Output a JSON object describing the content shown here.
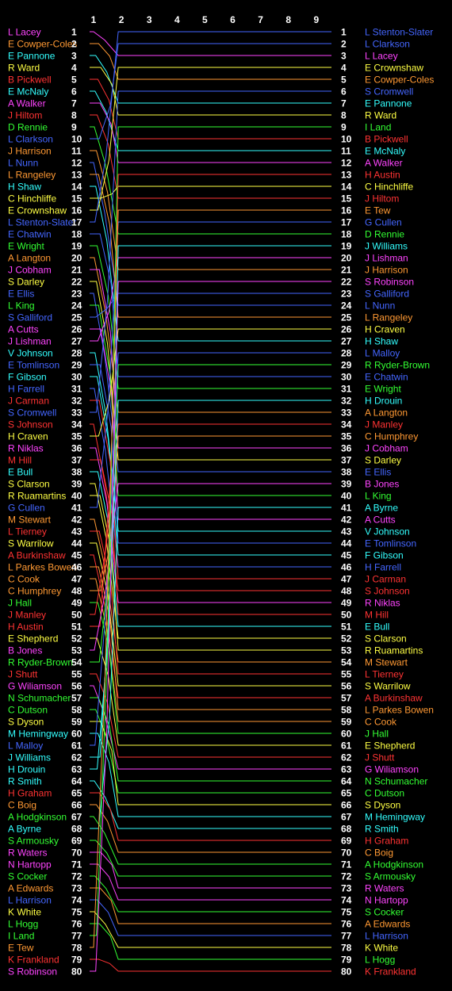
{
  "palette": {
    "magenta": "#ff44ff",
    "orange": "#ff9933",
    "cyan": "#33ffff",
    "yellow": "#ffff44",
    "red": "#ff3333",
    "blue": "#4466ff",
    "green": "#33ff33",
    "white": "#ffffff",
    "background": "#000000"
  },
  "chart_data": {
    "type": "line",
    "x": [
      1,
      2,
      3,
      4,
      5,
      6,
      7,
      8,
      9
    ],
    "xlim": [
      1,
      9
    ],
    "ylim": [
      1,
      80
    ],
    "y_inverted": true,
    "grid": false,
    "start_order": [
      {
        "name": "L Lacey",
        "color": "magenta"
      },
      {
        "name": "E Cowper-Coles",
        "color": "orange"
      },
      {
        "name": "E Pannone",
        "color": "cyan"
      },
      {
        "name": "R Ward",
        "color": "yellow"
      },
      {
        "name": "B Pickwell",
        "color": "red"
      },
      {
        "name": "E McNaly",
        "color": "cyan"
      },
      {
        "name": "A Walker",
        "color": "magenta"
      },
      {
        "name": "J Hiltom",
        "color": "red"
      },
      {
        "name": "D Rennie",
        "color": "green"
      },
      {
        "name": "L Clarkson",
        "color": "blue"
      },
      {
        "name": "J Harrison",
        "color": "orange"
      },
      {
        "name": "L Nunn",
        "color": "blue"
      },
      {
        "name": "L Rangeley",
        "color": "orange"
      },
      {
        "name": "H Shaw",
        "color": "cyan"
      },
      {
        "name": "C Hinchliffe",
        "color": "yellow"
      },
      {
        "name": "E Crownshaw",
        "color": "yellow"
      },
      {
        "name": "L Stenton-Slater",
        "color": "blue"
      },
      {
        "name": "E Chatwin",
        "color": "blue"
      },
      {
        "name": "E Wright",
        "color": "green"
      },
      {
        "name": "A Langton",
        "color": "orange"
      },
      {
        "name": "J Cobham",
        "color": "magenta"
      },
      {
        "name": "S Darley",
        "color": "yellow"
      },
      {
        "name": "E Ellis",
        "color": "blue"
      },
      {
        "name": "L King",
        "color": "green"
      },
      {
        "name": "S Galliford",
        "color": "blue"
      },
      {
        "name": "A Cutts",
        "color": "magenta"
      },
      {
        "name": "J Lishman",
        "color": "magenta"
      },
      {
        "name": "V Johnson",
        "color": "cyan"
      },
      {
        "name": "E Tomlinson",
        "color": "blue"
      },
      {
        "name": "F Gibson",
        "color": "cyan"
      },
      {
        "name": "H Farrell",
        "color": "blue"
      },
      {
        "name": "J Carman",
        "color": "red"
      },
      {
        "name": "S Cromwell",
        "color": "blue"
      },
      {
        "name": "S Johnson",
        "color": "red"
      },
      {
        "name": "H Craven",
        "color": "yellow"
      },
      {
        "name": "R Niklas",
        "color": "magenta"
      },
      {
        "name": "M Hill",
        "color": "red"
      },
      {
        "name": "E Bull",
        "color": "cyan"
      },
      {
        "name": "S Clarson",
        "color": "yellow"
      },
      {
        "name": "R Ruamartins",
        "color": "yellow"
      },
      {
        "name": "G Cullen",
        "color": "blue"
      },
      {
        "name": "M Stewart",
        "color": "orange"
      },
      {
        "name": "L Tierney",
        "color": "red"
      },
      {
        "name": "S Warrilow",
        "color": "yellow"
      },
      {
        "name": "A Burkinshaw",
        "color": "red"
      },
      {
        "name": "L Parkes Bowen",
        "color": "orange"
      },
      {
        "name": "C Cook",
        "color": "orange"
      },
      {
        "name": "C Humphrey",
        "color": "orange"
      },
      {
        "name": "J Hall",
        "color": "green"
      },
      {
        "name": "J Manley",
        "color": "red"
      },
      {
        "name": "H Austin",
        "color": "red"
      },
      {
        "name": "E Shepherd",
        "color": "yellow"
      },
      {
        "name": "B Jones",
        "color": "magenta"
      },
      {
        "name": "R Ryder-Brown",
        "color": "green"
      },
      {
        "name": "J Shutt",
        "color": "red"
      },
      {
        "name": "G Wiliamson",
        "color": "magenta"
      },
      {
        "name": "N Schumacher",
        "color": "green"
      },
      {
        "name": "C Dutson",
        "color": "green"
      },
      {
        "name": "S Dyson",
        "color": "yellow"
      },
      {
        "name": "M Hemingway",
        "color": "cyan"
      },
      {
        "name": "L Malloy",
        "color": "blue"
      },
      {
        "name": "J Williams",
        "color": "cyan"
      },
      {
        "name": "H Drouin",
        "color": "cyan"
      },
      {
        "name": "R Smith",
        "color": "cyan"
      },
      {
        "name": "H Graham",
        "color": "red"
      },
      {
        "name": "C Boig",
        "color": "orange"
      },
      {
        "name": "A Hodgkinson",
        "color": "green"
      },
      {
        "name": "A Byrne",
        "color": "cyan"
      },
      {
        "name": "S Armousky",
        "color": "green"
      },
      {
        "name": "R Waters",
        "color": "magenta"
      },
      {
        "name": "N Hartopp",
        "color": "magenta"
      },
      {
        "name": "S Cocker",
        "color": "green"
      },
      {
        "name": "A Edwards",
        "color": "orange"
      },
      {
        "name": "L Harrison",
        "color": "blue"
      },
      {
        "name": "K White",
        "color": "yellow"
      },
      {
        "name": "L Hogg",
        "color": "green"
      },
      {
        "name": "I Land",
        "color": "green"
      },
      {
        "name": "E Tew",
        "color": "orange"
      },
      {
        "name": "K Frankland",
        "color": "red"
      },
      {
        "name": "S Robinson",
        "color": "magenta"
      }
    ],
    "final_order": [
      "L Stenton-Slater",
      "L Clarkson",
      "L Lacey",
      "E Crownshaw",
      "E Cowper-Coles",
      "S Cromwell",
      "E Pannone",
      "R Ward",
      "I Land",
      "B Pickwell",
      "E McNaly",
      "A Walker",
      "H Austin",
      "C Hinchliffe",
      "J Hiltom",
      "E Tew",
      "G Cullen",
      "D Rennie",
      "J Williams",
      "J Lishman",
      "J Harrison",
      "S Robinson",
      "S Galliford",
      "L Nunn",
      "L Rangeley",
      "H Craven",
      "H Shaw",
      "L Malloy",
      "R Ryder-Brown",
      "E Chatwin",
      "E Wright",
      "H Drouin",
      "A Langton",
      "J Manley",
      "C Humphrey",
      "J Cobham",
      "S Darley",
      "E Ellis",
      "B Jones",
      "L King",
      "A Byrne",
      "A Cutts",
      "V Johnson",
      "E Tomlinson",
      "F Gibson",
      "H Farrell",
      "J Carman",
      "S Johnson",
      "R Niklas",
      "M Hill",
      "E Bull",
      "S Clarson",
      "R Ruamartins",
      "M Stewart",
      "L Tierney",
      "S Warrilow",
      "A Burkinshaw",
      "L Parkes Bowen",
      "C Cook",
      "J Hall",
      "E Shepherd",
      "J Shutt",
      "G Wiliamson",
      "N Schumacher",
      "C Dutson",
      "S Dyson",
      "M Hemingway",
      "R Smith",
      "H Graham",
      "C Boig",
      "A Hodgkinson",
      "S Armousky",
      "R Waters",
      "N Hartopp",
      "S Cocker",
      "A Edwards",
      "L Harrison",
      "K White",
      "L Hogg",
      "K Frankland"
    ],
    "tick_labels": [
      "1",
      "2",
      "3",
      "4",
      "5",
      "6",
      "7",
      "8",
      "9"
    ],
    "title": "",
    "xlabel": "",
    "ylabel": ""
  }
}
